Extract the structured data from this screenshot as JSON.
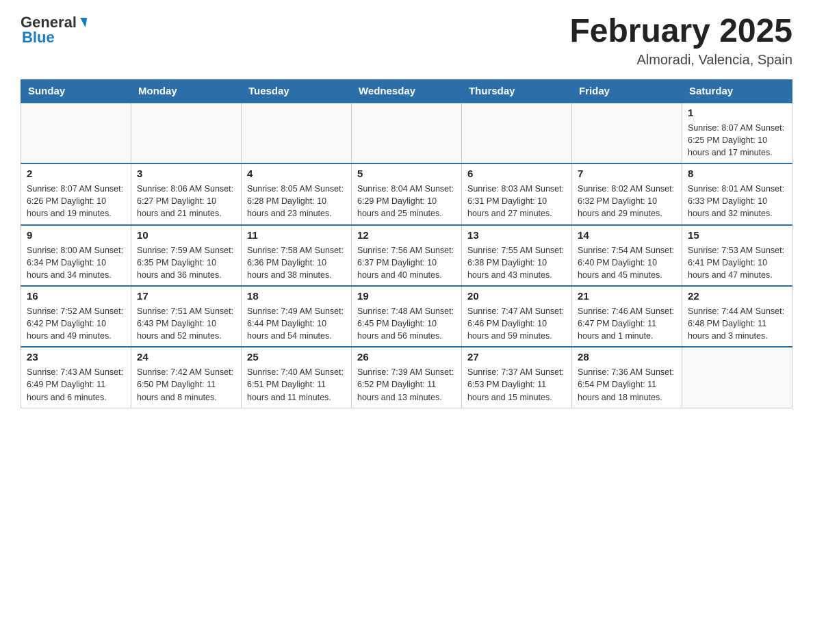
{
  "header": {
    "logo_text_general": "General",
    "logo_text_blue": "Blue",
    "main_title": "February 2025",
    "subtitle": "Almoradi, Valencia, Spain"
  },
  "calendar": {
    "days_of_week": [
      "Sunday",
      "Monday",
      "Tuesday",
      "Wednesday",
      "Thursday",
      "Friday",
      "Saturday"
    ],
    "weeks": [
      [
        {
          "day": "",
          "info": ""
        },
        {
          "day": "",
          "info": ""
        },
        {
          "day": "",
          "info": ""
        },
        {
          "day": "",
          "info": ""
        },
        {
          "day": "",
          "info": ""
        },
        {
          "day": "",
          "info": ""
        },
        {
          "day": "1",
          "info": "Sunrise: 8:07 AM\nSunset: 6:25 PM\nDaylight: 10 hours and 17 minutes."
        }
      ],
      [
        {
          "day": "2",
          "info": "Sunrise: 8:07 AM\nSunset: 6:26 PM\nDaylight: 10 hours and 19 minutes."
        },
        {
          "day": "3",
          "info": "Sunrise: 8:06 AM\nSunset: 6:27 PM\nDaylight: 10 hours and 21 minutes."
        },
        {
          "day": "4",
          "info": "Sunrise: 8:05 AM\nSunset: 6:28 PM\nDaylight: 10 hours and 23 minutes."
        },
        {
          "day": "5",
          "info": "Sunrise: 8:04 AM\nSunset: 6:29 PM\nDaylight: 10 hours and 25 minutes."
        },
        {
          "day": "6",
          "info": "Sunrise: 8:03 AM\nSunset: 6:31 PM\nDaylight: 10 hours and 27 minutes."
        },
        {
          "day": "7",
          "info": "Sunrise: 8:02 AM\nSunset: 6:32 PM\nDaylight: 10 hours and 29 minutes."
        },
        {
          "day": "8",
          "info": "Sunrise: 8:01 AM\nSunset: 6:33 PM\nDaylight: 10 hours and 32 minutes."
        }
      ],
      [
        {
          "day": "9",
          "info": "Sunrise: 8:00 AM\nSunset: 6:34 PM\nDaylight: 10 hours and 34 minutes."
        },
        {
          "day": "10",
          "info": "Sunrise: 7:59 AM\nSunset: 6:35 PM\nDaylight: 10 hours and 36 minutes."
        },
        {
          "day": "11",
          "info": "Sunrise: 7:58 AM\nSunset: 6:36 PM\nDaylight: 10 hours and 38 minutes."
        },
        {
          "day": "12",
          "info": "Sunrise: 7:56 AM\nSunset: 6:37 PM\nDaylight: 10 hours and 40 minutes."
        },
        {
          "day": "13",
          "info": "Sunrise: 7:55 AM\nSunset: 6:38 PM\nDaylight: 10 hours and 43 minutes."
        },
        {
          "day": "14",
          "info": "Sunrise: 7:54 AM\nSunset: 6:40 PM\nDaylight: 10 hours and 45 minutes."
        },
        {
          "day": "15",
          "info": "Sunrise: 7:53 AM\nSunset: 6:41 PM\nDaylight: 10 hours and 47 minutes."
        }
      ],
      [
        {
          "day": "16",
          "info": "Sunrise: 7:52 AM\nSunset: 6:42 PM\nDaylight: 10 hours and 49 minutes."
        },
        {
          "day": "17",
          "info": "Sunrise: 7:51 AM\nSunset: 6:43 PM\nDaylight: 10 hours and 52 minutes."
        },
        {
          "day": "18",
          "info": "Sunrise: 7:49 AM\nSunset: 6:44 PM\nDaylight: 10 hours and 54 minutes."
        },
        {
          "day": "19",
          "info": "Sunrise: 7:48 AM\nSunset: 6:45 PM\nDaylight: 10 hours and 56 minutes."
        },
        {
          "day": "20",
          "info": "Sunrise: 7:47 AM\nSunset: 6:46 PM\nDaylight: 10 hours and 59 minutes."
        },
        {
          "day": "21",
          "info": "Sunrise: 7:46 AM\nSunset: 6:47 PM\nDaylight: 11 hours and 1 minute."
        },
        {
          "day": "22",
          "info": "Sunrise: 7:44 AM\nSunset: 6:48 PM\nDaylight: 11 hours and 3 minutes."
        }
      ],
      [
        {
          "day": "23",
          "info": "Sunrise: 7:43 AM\nSunset: 6:49 PM\nDaylight: 11 hours and 6 minutes."
        },
        {
          "day": "24",
          "info": "Sunrise: 7:42 AM\nSunset: 6:50 PM\nDaylight: 11 hours and 8 minutes."
        },
        {
          "day": "25",
          "info": "Sunrise: 7:40 AM\nSunset: 6:51 PM\nDaylight: 11 hours and 11 minutes."
        },
        {
          "day": "26",
          "info": "Sunrise: 7:39 AM\nSunset: 6:52 PM\nDaylight: 11 hours and 13 minutes."
        },
        {
          "day": "27",
          "info": "Sunrise: 7:37 AM\nSunset: 6:53 PM\nDaylight: 11 hours and 15 minutes."
        },
        {
          "day": "28",
          "info": "Sunrise: 7:36 AM\nSunset: 6:54 PM\nDaylight: 11 hours and 18 minutes."
        },
        {
          "day": "",
          "info": ""
        }
      ]
    ]
  }
}
